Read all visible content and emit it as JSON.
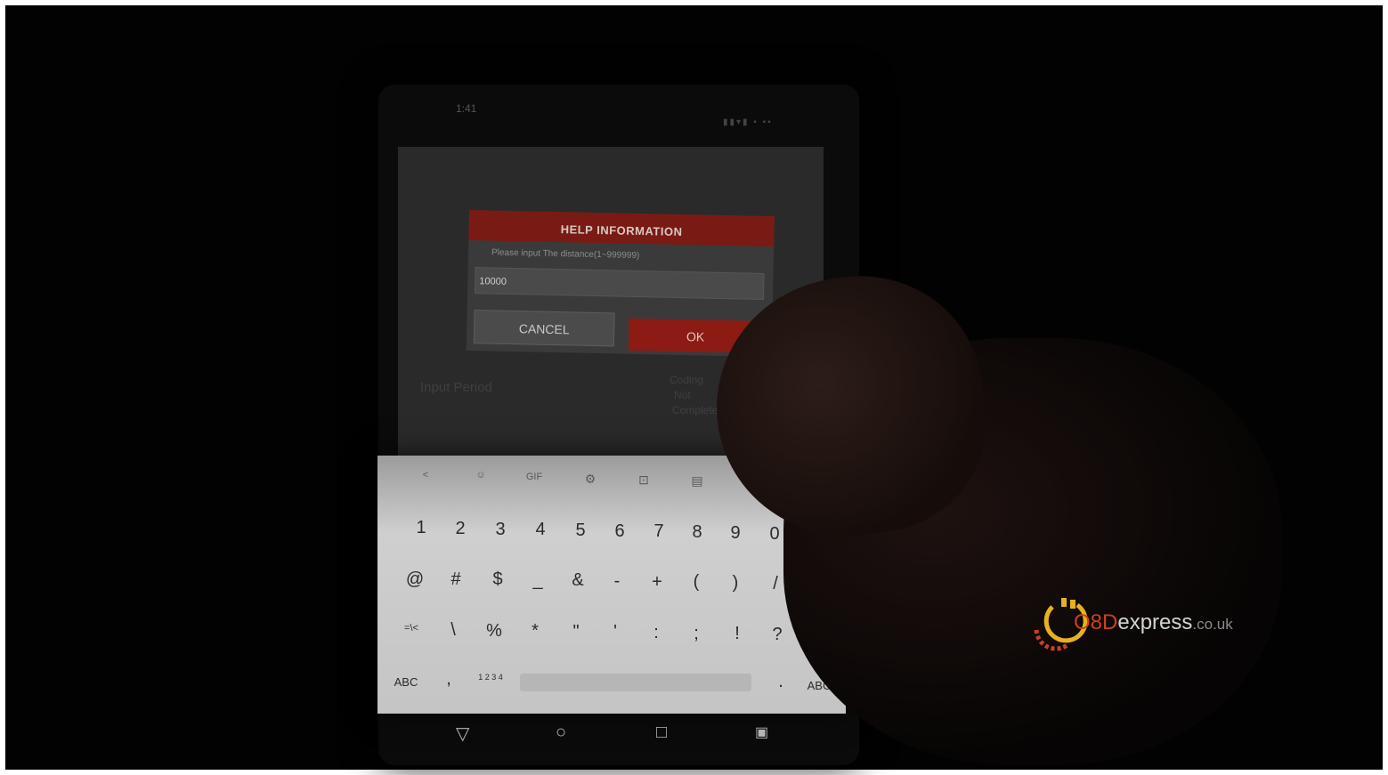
{
  "dialog": {
    "title": "HELP INFORMATION",
    "message": "Please input The distance(1~999999)",
    "input_value": "10000",
    "cancel_label": "CANCEL",
    "ok_label": "OK"
  },
  "background": {
    "label_left": "Input Period",
    "label_right_1": "Coding",
    "label_right_2": "Not",
    "label_right_3": "Completed"
  },
  "keyboard": {
    "toolbar": [
      "<",
      "☺",
      "GIF",
      "⚙",
      "⊡",
      "▤"
    ],
    "row1": [
      "1",
      "2",
      "3",
      "4",
      "5",
      "6",
      "7",
      "8",
      "9",
      "0"
    ],
    "row2": [
      "@",
      "#",
      "$",
      "_",
      "&",
      "-",
      "+",
      "(",
      ")",
      "/"
    ],
    "row3": [
      "=\\<",
      "\\",
      "%",
      "*",
      "\"",
      "'",
      ":",
      ";",
      "!",
      "?",
      "=\\<"
    ],
    "row4_left": "ABC",
    "row4_comma": ",",
    "row4_fraction": "1 2 3 4",
    "row4_dot": ".",
    "row4_right": "ABC",
    "enter_icon": "enter-icon"
  },
  "status_bar": {
    "time": "1:41"
  },
  "watermark": {
    "brand_o": "O",
    "brand_8d": "8D",
    "brand_express": "express",
    "brand_tld": ".co.uk"
  },
  "colors": {
    "dialog_header": "#7a1a14",
    "ok_button": "#8c1b14",
    "enter_key": "#3b78c8",
    "logo_red": "#c8421f",
    "logo_yellow": "#e6b21e"
  }
}
